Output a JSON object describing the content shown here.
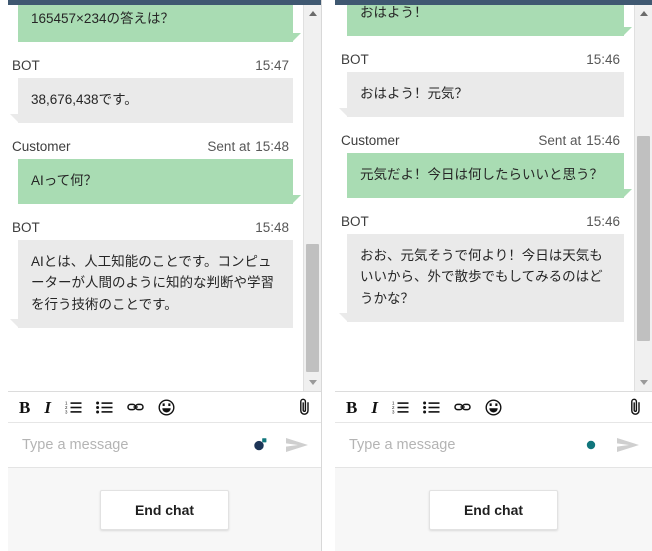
{
  "panels": [
    {
      "id": "left",
      "messages": [
        {
          "role": "customer",
          "sender": "",
          "time": "",
          "sent_prefix": "",
          "text": "165457×234の答えは？",
          "partial_top": true
        },
        {
          "role": "bot",
          "sender": "BOT",
          "time": "15:47",
          "sent_prefix": "",
          "text": "38,676,438です。"
        },
        {
          "role": "customer",
          "sender": "Customer",
          "time": "15:48",
          "sent_prefix": "Sent at",
          "text": "AIって何？"
        },
        {
          "role": "bot",
          "sender": "BOT",
          "time": "15:48",
          "sent_prefix": "",
          "text": "AIとは、人工知能のことです。コンピューターが人間のように知的な判断や学習を行う技術のことです。"
        }
      ],
      "composer": {
        "placeholder": "Type a message",
        "value": "",
        "bold_label": "B",
        "italic_label": "I",
        "numbered_list_label": "numbered-list",
        "bullet_list_label": "bullet-list",
        "link_label": "link",
        "emoji_label": "emoji",
        "attach_label": "attach",
        "send_label": "send",
        "status_icon": "bot-badge-icon"
      },
      "footer": {
        "end_chat_label": "End chat"
      },
      "scrollbar": {
        "thumb_top_pct": 62,
        "thumb_height_pct": 33
      }
    },
    {
      "id": "right",
      "messages": [
        {
          "role": "customer",
          "sender": "",
          "time": "",
          "sent_prefix": "",
          "text": "おはよう！",
          "partial_top": true
        },
        {
          "role": "bot",
          "sender": "BOT",
          "time": "15:46",
          "sent_prefix": "",
          "text": "おはよう！元気？"
        },
        {
          "role": "customer",
          "sender": "Customer",
          "time": "15:46",
          "sent_prefix": "Sent at",
          "text": "元気だよ！今日は何したらいいと思う？"
        },
        {
          "role": "bot",
          "sender": "BOT",
          "time": "15:46",
          "sent_prefix": "",
          "text": "おお、元気そうで何より！今日は天気もいいから、外で散歩でもしてみるのはどうかな？"
        }
      ],
      "composer": {
        "placeholder": "Type a message",
        "value": "",
        "bold_label": "B",
        "italic_label": "I",
        "numbered_list_label": "numbered-list",
        "bullet_list_label": "bullet-list",
        "link_label": "link",
        "emoji_label": "emoji",
        "attach_label": "attach",
        "send_label": "send",
        "status_icon": "teal-dot-icon"
      },
      "footer": {
        "end_chat_label": "End chat"
      },
      "scrollbar": {
        "thumb_top_pct": 34,
        "thumb_height_pct": 53
      }
    }
  ],
  "colors": {
    "customer_bubble": "#a9dcb3",
    "bot_bubble": "#eaeaea",
    "topbar": "#3f5871",
    "accent_teal": "#11767c",
    "footer_bg": "#f7f7f7"
  }
}
